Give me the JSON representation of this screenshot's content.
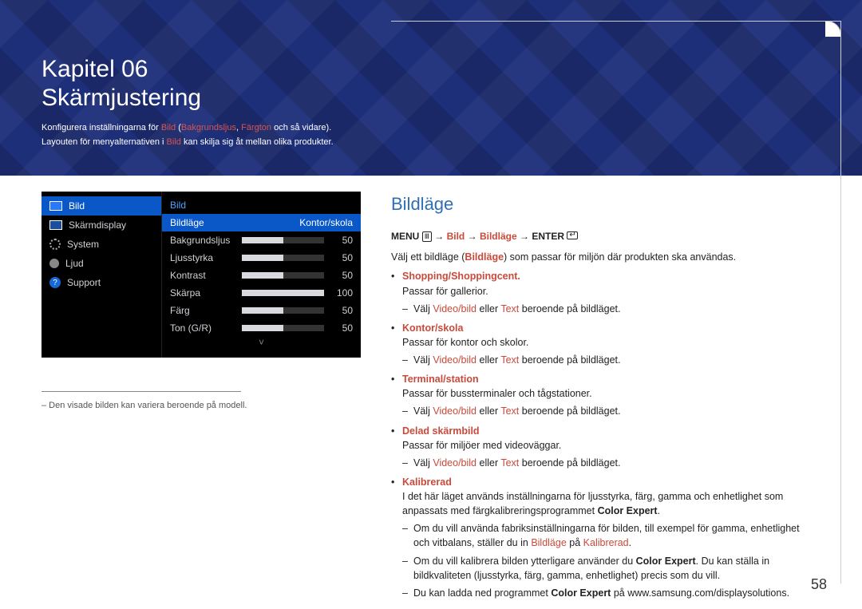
{
  "chapter": {
    "num": "Kapitel 06",
    "title": "Skärmjustering",
    "sub1_pre": "Konfigurera inställningarna för ",
    "sub1_bild": "Bild",
    "sub1_paren_open": " (",
    "sub1_bakgrund": "Bakgrundsljus",
    "sub1_comma": ", ",
    "sub1_fargton": "Färgton",
    "sub1_rest": " och så vidare).",
    "sub2_pre": "Layouten för menyalternativen i ",
    "sub2_bild": "Bild",
    "sub2_rest": " kan skilja sig åt mellan olika produkter."
  },
  "menu": {
    "left": [
      {
        "label": "Bild",
        "selected": true,
        "icon": "box"
      },
      {
        "label": "Skärmdisplay",
        "selected": false,
        "icon": "box"
      },
      {
        "label": "System",
        "selected": false,
        "icon": "gear"
      },
      {
        "label": "Ljud",
        "selected": false,
        "icon": "speaker"
      },
      {
        "label": "Support",
        "selected": false,
        "icon": "question"
      }
    ],
    "right_header": "Bild",
    "right_selected": {
      "label": "Bildläge",
      "value": "Kontor/skola"
    },
    "sliders": [
      {
        "label": "Bakgrundsljus",
        "value": 50
      },
      {
        "label": "Ljusstyrka",
        "value": 50
      },
      {
        "label": "Kontrast",
        "value": 50
      },
      {
        "label": "Skärpa",
        "value": 100
      },
      {
        "label": "Färg",
        "value": 50
      },
      {
        "label": "Ton (G/R)",
        "value": 50
      }
    ],
    "chevron": "˅"
  },
  "footnote": "– Den visade bilden kan variera beroende på modell.",
  "content": {
    "heading": "Bildläge",
    "path": {
      "menu_label": "MENU",
      "menu_glyph": "Ⅲ",
      "arrow": "→",
      "bild": "Bild",
      "bildlage": "Bildläge",
      "enter": "ENTER"
    },
    "lead_pre": "Välj ett bildläge (",
    "lead_hl": "Bildläge",
    "lead_post": ") som passar för miljön där produkten ska användas.",
    "items": [
      {
        "title": "Shopping/Shoppingcent.",
        "desc": "Passar för gallerior.",
        "sub_pre": "Välj ",
        "sub_hl1": "Video/bild",
        "sub_mid": " eller ",
        "sub_hl2": "Text",
        "sub_post": " beroende på bildläget."
      },
      {
        "title": "Kontor/skola",
        "desc": "Passar för kontor och skolor.",
        "sub_pre": "Välj ",
        "sub_hl1": "Video/bild",
        "sub_mid": " eller ",
        "sub_hl2": "Text",
        "sub_post": " beroende på bildläget."
      },
      {
        "title": "Terminal/station",
        "desc": "Passar för bussterminaler och tågstationer.",
        "sub_pre": "Välj ",
        "sub_hl1": "Video/bild",
        "sub_mid": " eller ",
        "sub_hl2": "Text",
        "sub_post": " beroende på bildläget."
      },
      {
        "title": "Delad skärmbild",
        "desc": "Passar för miljöer med videoväggar.",
        "sub_pre": "Välj ",
        "sub_hl1": "Video/bild",
        "sub_mid": " eller ",
        "sub_hl2": "Text",
        "sub_post": " beroende på bildläget."
      }
    ],
    "kalibrerad": {
      "title": "Kalibrerad",
      "desc_pre": "I det här läget används inställningarna för ljusstyrka, färg, gamma och enhetlighet som anpassats med färgkalibreringsprogrammet ",
      "desc_bold": "Color Expert",
      "desc_post": ".",
      "d1_pre": "Om du vill använda fabriksinställningarna för bilden, till exempel för gamma, enhetlighet och vitbalans, ställer du in ",
      "d1_h1": "Bildläge",
      "d1_mid": " på ",
      "d1_h2": "Kalibrerad",
      "d1_post": ".",
      "d2_pre": "Om du vill kalibrera bilden ytterligare använder du ",
      "d2_bold": "Color Expert",
      "d2_post": ". Du kan ställa in bildkvaliteten (ljusstyrka, färg, gamma, enhetlighet) precis som du vill.",
      "d3_pre": "Du kan ladda ned programmet ",
      "d3_bold": "Color Expert",
      "d3_post": " på www.samsung.com/displaysolutions."
    }
  },
  "page_number": "58"
}
